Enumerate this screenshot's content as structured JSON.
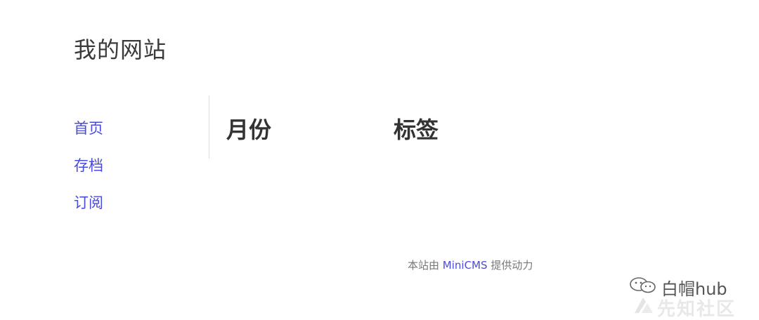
{
  "site": {
    "title": "我的网站"
  },
  "nav": {
    "items": [
      {
        "label": "首页"
      },
      {
        "label": "存档"
      },
      {
        "label": "订阅"
      }
    ]
  },
  "main": {
    "months_heading": "月份",
    "tags_heading": "标签"
  },
  "footer": {
    "prefix": "本站由",
    "link_text": "MiniCMS",
    "suffix": "提供动力"
  },
  "watermark": {
    "account": "白帽hub",
    "community": "先知社区",
    "icon": "wechat-icon"
  },
  "colors": {
    "link": "#4b4bd9",
    "text": "#333333",
    "muted": "#777777"
  }
}
